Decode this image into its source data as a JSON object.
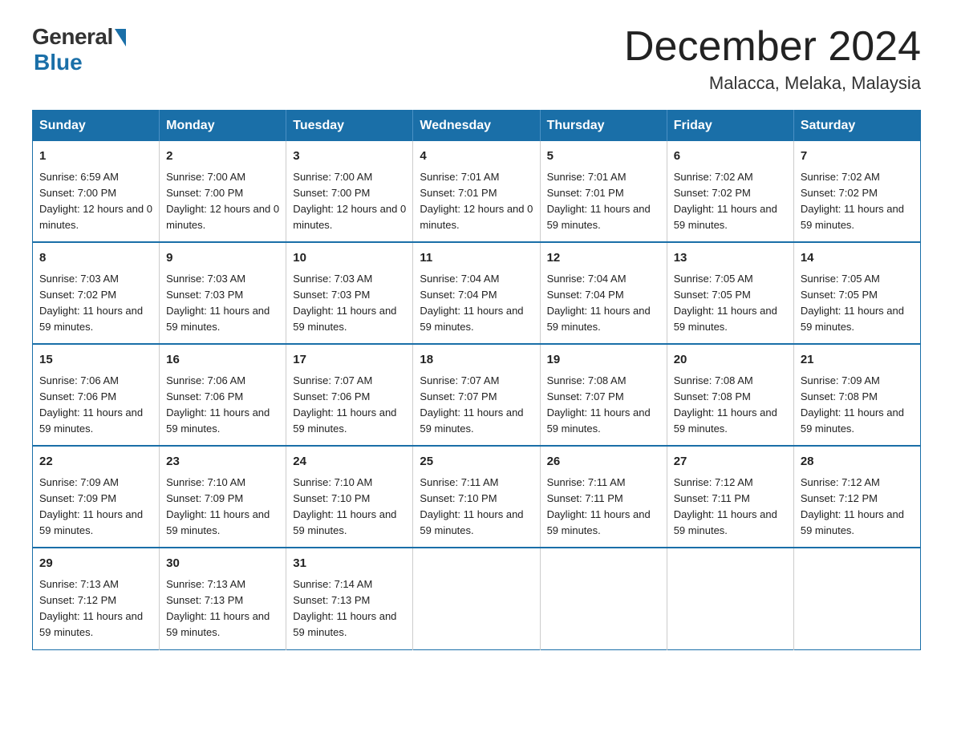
{
  "logo": {
    "general": "General",
    "blue": "Blue"
  },
  "title": {
    "month": "December 2024",
    "location": "Malacca, Melaka, Malaysia"
  },
  "weekdays": [
    "Sunday",
    "Monday",
    "Tuesday",
    "Wednesday",
    "Thursday",
    "Friday",
    "Saturday"
  ],
  "weeks": [
    [
      {
        "day": "1",
        "sunrise": "6:59 AM",
        "sunset": "7:00 PM",
        "daylight": "12 hours and 0 minutes."
      },
      {
        "day": "2",
        "sunrise": "7:00 AM",
        "sunset": "7:00 PM",
        "daylight": "12 hours and 0 minutes."
      },
      {
        "day": "3",
        "sunrise": "7:00 AM",
        "sunset": "7:00 PM",
        "daylight": "12 hours and 0 minutes."
      },
      {
        "day": "4",
        "sunrise": "7:01 AM",
        "sunset": "7:01 PM",
        "daylight": "12 hours and 0 minutes."
      },
      {
        "day": "5",
        "sunrise": "7:01 AM",
        "sunset": "7:01 PM",
        "daylight": "11 hours and 59 minutes."
      },
      {
        "day": "6",
        "sunrise": "7:02 AM",
        "sunset": "7:02 PM",
        "daylight": "11 hours and 59 minutes."
      },
      {
        "day": "7",
        "sunrise": "7:02 AM",
        "sunset": "7:02 PM",
        "daylight": "11 hours and 59 minutes."
      }
    ],
    [
      {
        "day": "8",
        "sunrise": "7:03 AM",
        "sunset": "7:02 PM",
        "daylight": "11 hours and 59 minutes."
      },
      {
        "day": "9",
        "sunrise": "7:03 AM",
        "sunset": "7:03 PM",
        "daylight": "11 hours and 59 minutes."
      },
      {
        "day": "10",
        "sunrise": "7:03 AM",
        "sunset": "7:03 PM",
        "daylight": "11 hours and 59 minutes."
      },
      {
        "day": "11",
        "sunrise": "7:04 AM",
        "sunset": "7:04 PM",
        "daylight": "11 hours and 59 minutes."
      },
      {
        "day": "12",
        "sunrise": "7:04 AM",
        "sunset": "7:04 PM",
        "daylight": "11 hours and 59 minutes."
      },
      {
        "day": "13",
        "sunrise": "7:05 AM",
        "sunset": "7:05 PM",
        "daylight": "11 hours and 59 minutes."
      },
      {
        "day": "14",
        "sunrise": "7:05 AM",
        "sunset": "7:05 PM",
        "daylight": "11 hours and 59 minutes."
      }
    ],
    [
      {
        "day": "15",
        "sunrise": "7:06 AM",
        "sunset": "7:06 PM",
        "daylight": "11 hours and 59 minutes."
      },
      {
        "day": "16",
        "sunrise": "7:06 AM",
        "sunset": "7:06 PM",
        "daylight": "11 hours and 59 minutes."
      },
      {
        "day": "17",
        "sunrise": "7:07 AM",
        "sunset": "7:06 PM",
        "daylight": "11 hours and 59 minutes."
      },
      {
        "day": "18",
        "sunrise": "7:07 AM",
        "sunset": "7:07 PM",
        "daylight": "11 hours and 59 minutes."
      },
      {
        "day": "19",
        "sunrise": "7:08 AM",
        "sunset": "7:07 PM",
        "daylight": "11 hours and 59 minutes."
      },
      {
        "day": "20",
        "sunrise": "7:08 AM",
        "sunset": "7:08 PM",
        "daylight": "11 hours and 59 minutes."
      },
      {
        "day": "21",
        "sunrise": "7:09 AM",
        "sunset": "7:08 PM",
        "daylight": "11 hours and 59 minutes."
      }
    ],
    [
      {
        "day": "22",
        "sunrise": "7:09 AM",
        "sunset": "7:09 PM",
        "daylight": "11 hours and 59 minutes."
      },
      {
        "day": "23",
        "sunrise": "7:10 AM",
        "sunset": "7:09 PM",
        "daylight": "11 hours and 59 minutes."
      },
      {
        "day": "24",
        "sunrise": "7:10 AM",
        "sunset": "7:10 PM",
        "daylight": "11 hours and 59 minutes."
      },
      {
        "day": "25",
        "sunrise": "7:11 AM",
        "sunset": "7:10 PM",
        "daylight": "11 hours and 59 minutes."
      },
      {
        "day": "26",
        "sunrise": "7:11 AM",
        "sunset": "7:11 PM",
        "daylight": "11 hours and 59 minutes."
      },
      {
        "day": "27",
        "sunrise": "7:12 AM",
        "sunset": "7:11 PM",
        "daylight": "11 hours and 59 minutes."
      },
      {
        "day": "28",
        "sunrise": "7:12 AM",
        "sunset": "7:12 PM",
        "daylight": "11 hours and 59 minutes."
      }
    ],
    [
      {
        "day": "29",
        "sunrise": "7:13 AM",
        "sunset": "7:12 PM",
        "daylight": "11 hours and 59 minutes."
      },
      {
        "day": "30",
        "sunrise": "7:13 AM",
        "sunset": "7:13 PM",
        "daylight": "11 hours and 59 minutes."
      },
      {
        "day": "31",
        "sunrise": "7:14 AM",
        "sunset": "7:13 PM",
        "daylight": "11 hours and 59 minutes."
      },
      null,
      null,
      null,
      null
    ]
  ]
}
